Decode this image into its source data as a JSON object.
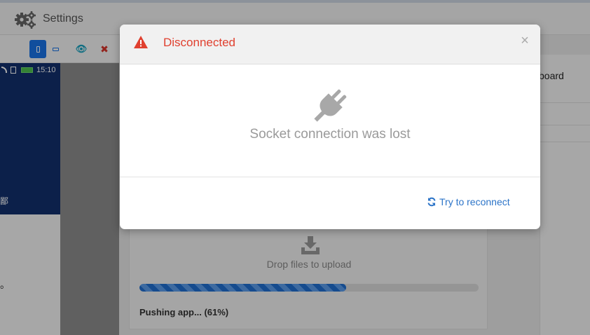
{
  "topbar": {
    "title": "Settings",
    "icon": "gears-icon"
  },
  "toolbar": {
    "portrait_icon": "portrait-icon",
    "landscape_icon": "landscape-icon",
    "view_icon": "eye-icon",
    "close_icon": "close-icon",
    "close_glyph": "✖",
    "view_glyph": "👁"
  },
  "device": {
    "time": "15:10",
    "bottom_glyph": "鄙"
  },
  "left_panel": {
    "glyph": "。"
  },
  "right_panel": {
    "keyboard_label": "board"
  },
  "upload": {
    "drop_label": "Drop files to upload",
    "progress_percent": 61,
    "status": "Pushing app... (61%)"
  },
  "modal": {
    "title": "Disconnected",
    "close_glyph": "×",
    "message": "Socket connection was lost",
    "reconnect_label": "Try to reconnect"
  },
  "colors": {
    "accent": "#2c74c8",
    "error": "#e0402f",
    "device_bg": "#12306e",
    "progress": "#1f6fd1"
  }
}
